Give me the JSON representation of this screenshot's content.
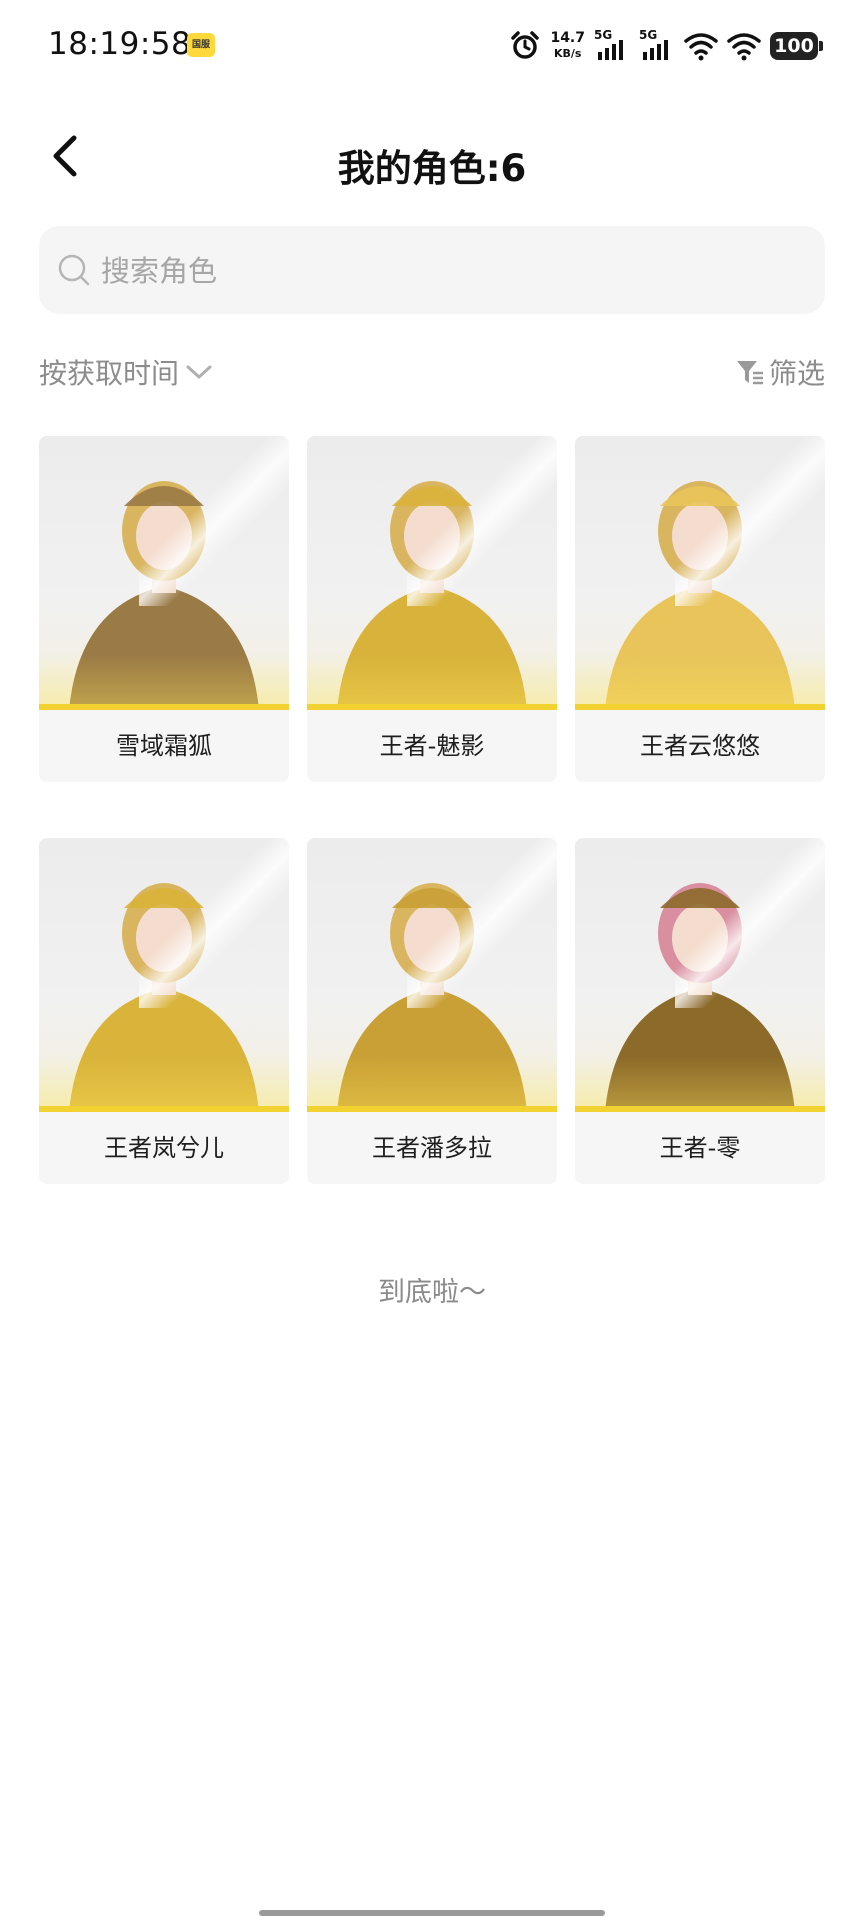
{
  "status_bar": {
    "time": "18:19:58",
    "badge": "国服",
    "net_speed_value": "14.7",
    "net_speed_unit": "KB/s",
    "signal_1_label": "5G",
    "signal_2_label": "5G",
    "battery": "100",
    "icons": [
      "alarm-icon",
      "signal-icon",
      "signal-icon",
      "wifi-icon",
      "wifi-icon",
      "battery-icon"
    ]
  },
  "header": {
    "title": "我的角色:6",
    "back_icon": "chevron-left-icon"
  },
  "search": {
    "placeholder": "搜索角色",
    "value": ""
  },
  "toolbar": {
    "sort_label": "按获取时间",
    "filter_label": "筛选"
  },
  "characters": [
    {
      "name": "雪域霜狐",
      "accent": "#9a7a45"
    },
    {
      "name": "王者-魅影",
      "accent": "#d8b23a"
    },
    {
      "name": "王者云悠悠",
      "accent": "#e8c45a"
    },
    {
      "name": "王者岚兮儿",
      "accent": "#d9b33a"
    },
    {
      "name": "王者潘多拉",
      "accent": "#c9a035"
    },
    {
      "name": "王者-零",
      "accent": "#8c6a2a"
    }
  ],
  "footer": {
    "end_note": "到底啦～"
  },
  "colors": {
    "card_bg": "#f6f6f6",
    "gold": "#f2d230",
    "muted_text": "#8c8c8c"
  }
}
